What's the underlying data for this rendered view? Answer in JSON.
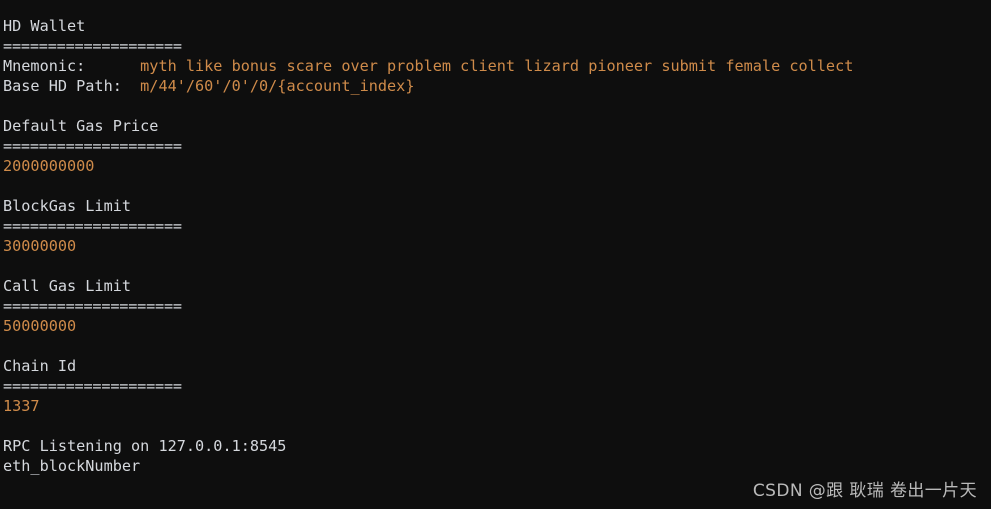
{
  "terminal": {
    "background_color": "#0e0e0e",
    "text_color": "#d5d8dd",
    "value_color": "#cf8b4a",
    "rule": "====================",
    "hd_wallet": {
      "title": "HD Wallet",
      "mnemonic_label": "Mnemonic:      ",
      "mnemonic_value": "myth like bonus scare over problem client lizard pioneer submit female collect",
      "path_label": "Base HD Path:  ",
      "path_value": "m/44'/60'/0'/0/{account_index}"
    },
    "sections": [
      {
        "title": "Default Gas Price",
        "value": "2000000000"
      },
      {
        "title": "BlockGas Limit",
        "value": "30000000"
      },
      {
        "title": "Call Gas Limit",
        "value": "50000000"
      },
      {
        "title": "Chain Id",
        "value": "1337"
      }
    ],
    "rpc_line": "RPC Listening on 127.0.0.1:8545",
    "log_line": "eth_blockNumber"
  },
  "watermark": {
    "text": "CSDN @跟 耿瑞 卷出一片天"
  }
}
